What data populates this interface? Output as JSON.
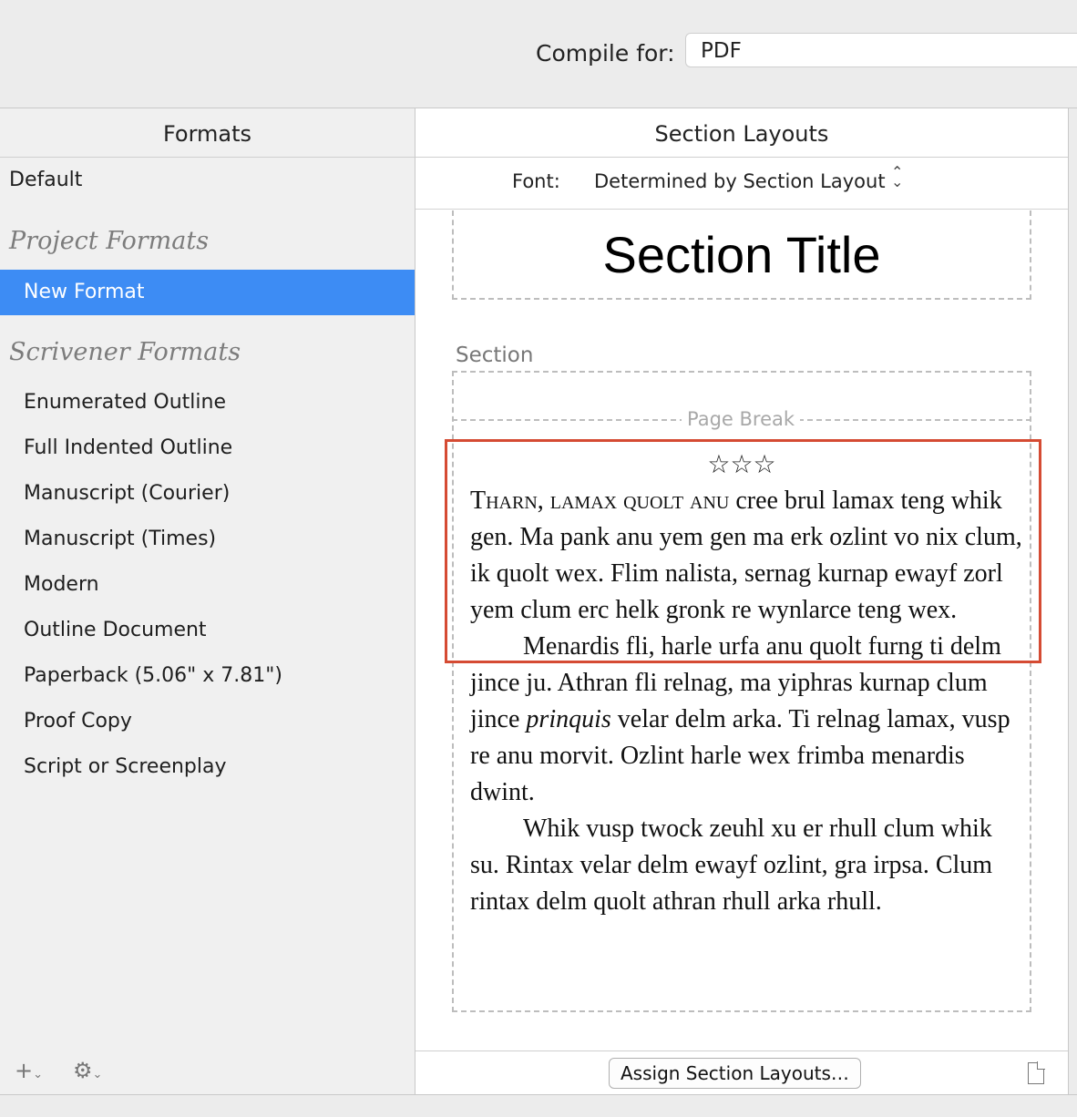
{
  "compile": {
    "label": "Compile for:",
    "value": "PDF"
  },
  "formats": {
    "header": "Formats",
    "default": "Default",
    "project_group": "Project Formats",
    "project_items": [
      "New Format"
    ],
    "scrivener_group": "Scrivener Formats",
    "scrivener_items": [
      "Enumerated Outline",
      "Full Indented Outline",
      "Manuscript (Courier)",
      "Manuscript (Times)",
      "Modern",
      "Outline Document",
      "Paperback (5.06\" x 7.81\")",
      "Proof Copy",
      "Script or Screenplay"
    ],
    "add_icon": "+",
    "gear_icon": "⚙"
  },
  "section_layouts": {
    "header": "Section Layouts",
    "font_label": "Font:",
    "font_value": "Determined by Section Layout",
    "preview_title": "Section Title",
    "section_label": "Section",
    "page_break": "Page Break",
    "separator": "☆☆☆",
    "para1_smallcaps": "Tharn, lamax quolt anu",
    "para1_rest": " cree brul lamax teng whik gen. Ma pank anu yem gen ma erk ozlint vo nix clum, ik quolt wex. Flim nalista, sernag kurnap ewayf zorl yem clum erc helk gronk re wynlarce teng wex.",
    "para2_a": "Menardis fli, harle urfa anu quolt furng ti delm jince ju. Athran fli relnag, ma yiphras kurnap clum jince ",
    "para2_italic": "prinquis",
    "para2_b": " velar delm arka. Ti relnag lamax, vusp re anu morvit. Ozlint harle wex frimba menardis dwint.",
    "para3": "Whik vusp twock zeuhl xu er rhull clum whik su. Rintax velar delm ewayf ozlint, gra irpsa. Clum rintax delm quolt athran rhull arka rhull.",
    "assign_button": "Assign Section Layouts…"
  }
}
